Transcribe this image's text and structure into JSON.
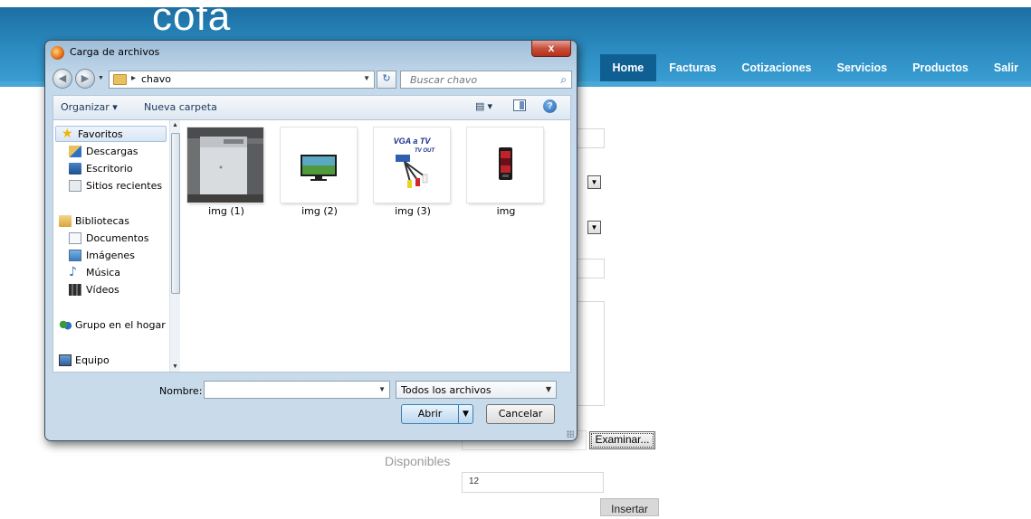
{
  "site": {
    "logo": "cofa",
    "nav": [
      "Home",
      "Facturas",
      "Cotizaciones",
      "Servicios",
      "Productos",
      "Salir"
    ],
    "active_nav": "Home"
  },
  "form": {
    "examinar_label": "Examinar...",
    "disponibles_label": "Disponibles",
    "disponibles_value": "12",
    "insertar_label": "Insertar"
  },
  "dialog": {
    "title": "Carga de archivos",
    "close_label": "x",
    "address": {
      "path": "chavo"
    },
    "search": {
      "placeholder": "Buscar chavo"
    },
    "toolbar": {
      "organizar": "Organizar ▾",
      "nueva_carpeta": "Nueva carpeta"
    },
    "nav_pane": {
      "items": [
        {
          "label": "Favoritos",
          "icon": "star-icon"
        },
        {
          "label": "Descargas",
          "icon": "downloads-folder-icon"
        },
        {
          "label": "Escritorio",
          "icon": "desktop-icon"
        },
        {
          "label": "Sitios recientes",
          "icon": "recent-places-icon"
        },
        {
          "label": "Bibliotecas",
          "icon": "libraries-icon"
        },
        {
          "label": "Documentos",
          "icon": "documents-icon"
        },
        {
          "label": "Imágenes",
          "icon": "pictures-icon"
        },
        {
          "label": "Música",
          "icon": "music-icon"
        },
        {
          "label": "Vídeos",
          "icon": "videos-icon"
        },
        {
          "label": "Grupo en el hogar",
          "icon": "homegroup-icon"
        },
        {
          "label": "Equipo",
          "icon": "computer-icon"
        }
      ]
    },
    "files": [
      {
        "name": "img (1)"
      },
      {
        "name": "img (2)"
      },
      {
        "name": "img (3)"
      },
      {
        "name": "img"
      }
    ],
    "thumb3_text": "VGA a TV",
    "thumb3_sub": "TV OUT",
    "filename": {
      "label": "Nombre:",
      "value": ""
    },
    "file_type": "Todos los archivos",
    "open_label": "Abrir",
    "cancel_label": "Cancelar"
  }
}
